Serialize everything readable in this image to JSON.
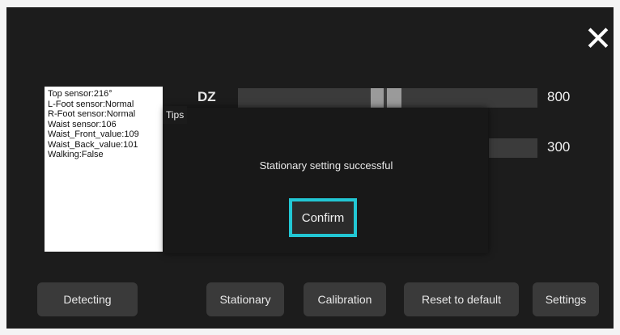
{
  "header": {
    "close_glyph": "✕"
  },
  "sensors": {
    "lines": [
      "Top sensor:216°",
      "L-Foot sensor:Normal",
      "R-Foot sensor:Normal",
      "Waist sensor:106",
      "Waist_Front_value:109",
      "Waist_Back_value:101",
      "Walking:False"
    ]
  },
  "controls": {
    "dz_label": "DZ",
    "dz_value": "800",
    "second_value": "300"
  },
  "dialog": {
    "title": "Tips",
    "message": "Stationary setting successful",
    "confirm_label": "Confirm"
  },
  "buttons": {
    "detecting": "Detecting",
    "stationary": "Stationary",
    "calibration": "Calibration",
    "reset": "Reset to default",
    "settings": "Settings"
  },
  "colors": {
    "background": "#1c1c1c",
    "accent": "#22c7d4",
    "button": "#3a3a3a"
  }
}
